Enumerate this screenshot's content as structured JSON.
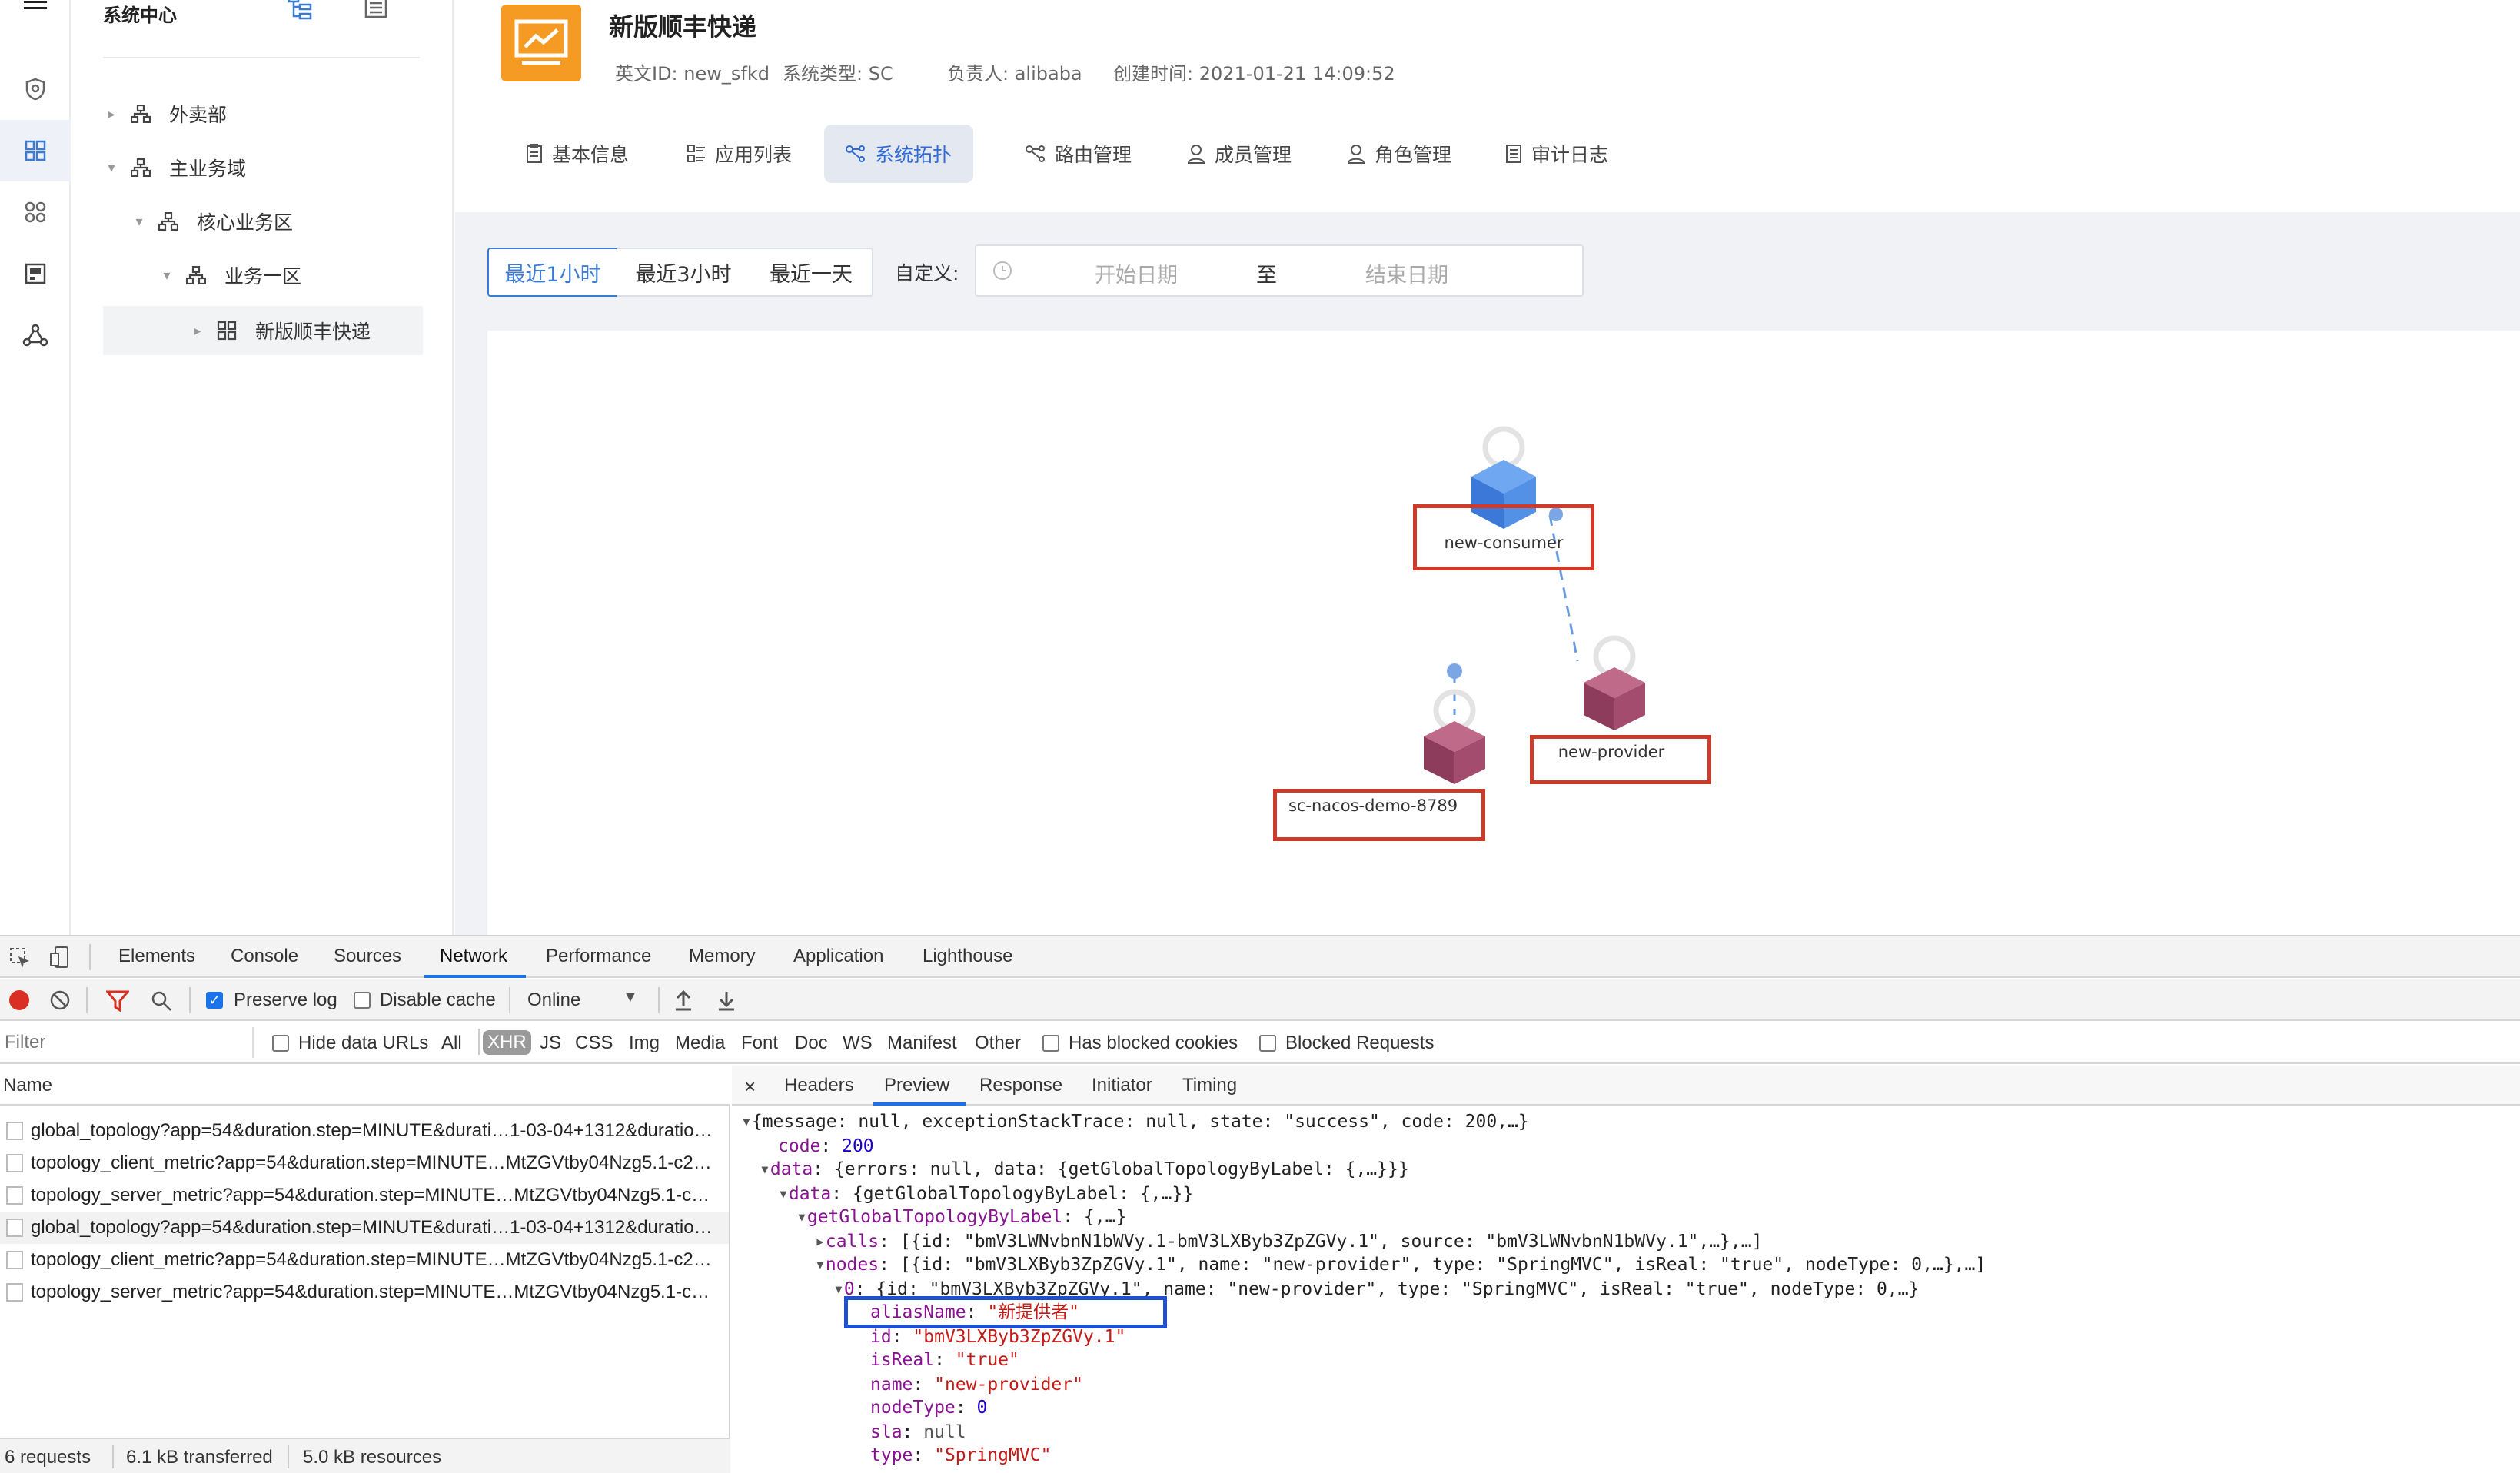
{
  "rail": {
    "menu_icon": "hamburger-menu-icon",
    "items": [
      {
        "icon": "shield-icon"
      },
      {
        "icon": "grid-apps-icon",
        "active": true
      },
      {
        "icon": "command-icon"
      },
      {
        "icon": "dashboard-icon"
      },
      {
        "icon": "network-triangle-icon"
      }
    ]
  },
  "tree": {
    "title": "系统中心",
    "nodes": [
      {
        "label": "外卖部"
      },
      {
        "label": "主业务域"
      },
      {
        "label": "核心业务区"
      },
      {
        "label": "业务一区"
      },
      {
        "label": "新版顺丰快递",
        "selected": true
      }
    ]
  },
  "header": {
    "name": "新版顺丰快递",
    "en_id": "英文ID: new_sfkd",
    "sys_type": "系统类型: SC",
    "owner": "负责人: alibaba",
    "created": "创建时间: 2021-01-21 14:09:52"
  },
  "tabs": [
    {
      "label": "基本信息"
    },
    {
      "label": "应用列表"
    },
    {
      "label": "系统拓扑",
      "active": true
    },
    {
      "label": "路由管理"
    },
    {
      "label": "成员管理"
    },
    {
      "label": "角色管理"
    },
    {
      "label": "审计日志"
    }
  ],
  "range": {
    "buttons": [
      "最近1小时",
      "最近3小时",
      "最近一天"
    ],
    "custom_label": "自定义:",
    "start_placeholder": "开始日期",
    "separator": "至",
    "end_placeholder": "结束日期"
  },
  "topology": {
    "nodes": [
      {
        "name": "new-consumer",
        "color": "#4a90e2"
      },
      {
        "name": "new-provider",
        "color": "#a04a6a"
      },
      {
        "name": "sc-nacos-demo-8789",
        "color": "#a04a6a"
      }
    ]
  },
  "devtools": {
    "tabs": [
      "Elements",
      "Console",
      "Sources",
      "Network",
      "Performance",
      "Memory",
      "Application",
      "Lighthouse"
    ],
    "active_tab": "Network",
    "toolbar": {
      "preserve_log": "Preserve log",
      "disable_cache": "Disable cache",
      "throttle": "Online"
    },
    "filter": {
      "placeholder": "Filter",
      "hide_data_urls": "Hide data URLs",
      "types": [
        "All",
        "XHR",
        "JS",
        "CSS",
        "Img",
        "Media",
        "Font",
        "Doc",
        "WS",
        "Manifest",
        "Other"
      ],
      "has_blocked": "Has blocked cookies",
      "blocked_requests": "Blocked Requests"
    },
    "requests_header": "Name",
    "requests": [
      "global_topology?app=54&duration.step=MINUTE&durati…1-03-04+1312&duratio…",
      "topology_client_metric?app=54&duration.step=MINUTE…MtZGVtby04Nzg5.1-c2…",
      "topology_server_metric?app=54&duration.step=MINUTE…MtZGVtby04Nzg5.1-c…",
      "global_topology?app=54&duration.step=MINUTE&durati…1-03-04+1312&duratio…",
      "topology_client_metric?app=54&duration.step=MINUTE…MtZGVtby04Nzg5.1-c2…",
      "topology_server_metric?app=54&duration.step=MINUTE…MtZGVtby04Nzg5.1-c…"
    ],
    "status": {
      "requests": "6 requests",
      "transferred": "6.1 kB transferred",
      "resources": "5.0 kB resources"
    },
    "preview_tabs": [
      "Headers",
      "Preview",
      "Response",
      "Initiator",
      "Timing"
    ],
    "active_preview_tab": "Preview",
    "preview": {
      "l1": "{message: null, exceptionStackTrace: null, state: \"success\", code: 200,…}",
      "code_key": "code",
      "code_val": "200",
      "data1": "{errors: null, data: {getGlobalTopologyByLabel: {,…}}}",
      "data2": "{getGlobalTopologyByLabel: {,…}}",
      "gg_key": "getGlobalTopologyByLabel",
      "gg_val": "{,…}",
      "calls": "[{id: \"bmV3LWNvbnN1bWVy.1-bmV3LXByb3ZpZGVy.1\", source: \"bmV3LWNvbnN1bWVy.1\",…},…]",
      "nodes": "[{id: \"bmV3LXByb3ZpZGVy.1\", name: \"new-provider\", type: \"SpringMVC\", isReal: \"true\", nodeType: 0,…},…]",
      "node0": "{id: \"bmV3LXByb3ZpZGVy.1\", name: \"new-provider\", type: \"SpringMVC\", isReal: \"true\", nodeType: 0,…}",
      "aliasName": "\"新提供者\"",
      "id": "\"bmV3LXByb3ZpZGVy.1\"",
      "isReal": "\"true\"",
      "name": "\"new-provider\"",
      "nodeType": "0",
      "sla": "null",
      "type": "\"SpringMVC\""
    }
  }
}
